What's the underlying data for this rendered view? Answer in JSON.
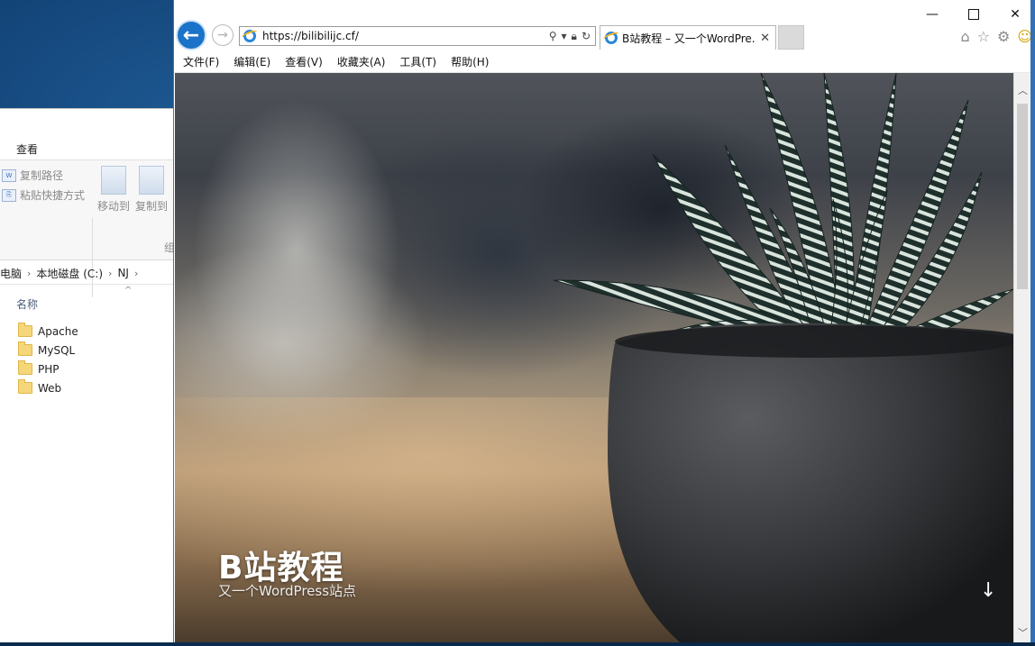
{
  "explorer": {
    "ribbon_tab": "查看",
    "copy_path": "复制路径",
    "paste_shortcut": "粘贴快捷方式",
    "move_to": "移动到",
    "copy_to": "复制到",
    "group_label": "组",
    "breadcrumb": [
      "电脑",
      "本地磁盘 (C:)",
      "NJ"
    ],
    "column_header": "名称",
    "files": [
      "Apache",
      "MySQL",
      "PHP",
      "Web"
    ]
  },
  "browser": {
    "url": "https://bilibilijc.cf/",
    "tab_title": "B站教程 – 又一个WordPre...",
    "menu": [
      "文件(F)",
      "编辑(E)",
      "查看(V)",
      "收藏夹(A)",
      "工具(T)",
      "帮助(H)"
    ],
    "icons": [
      "back-icon",
      "forward-icon",
      "search-icon",
      "lock-icon",
      "refresh-icon",
      "home-icon",
      "favorites-star-icon",
      "settings-gear-icon",
      "smiley-feedback-icon"
    ]
  },
  "page": {
    "title": "B站教程",
    "subtitle": "又一个WordPress站点"
  },
  "colors": {
    "accent": "#1a73c8",
    "desktop": "#0c3667"
  }
}
